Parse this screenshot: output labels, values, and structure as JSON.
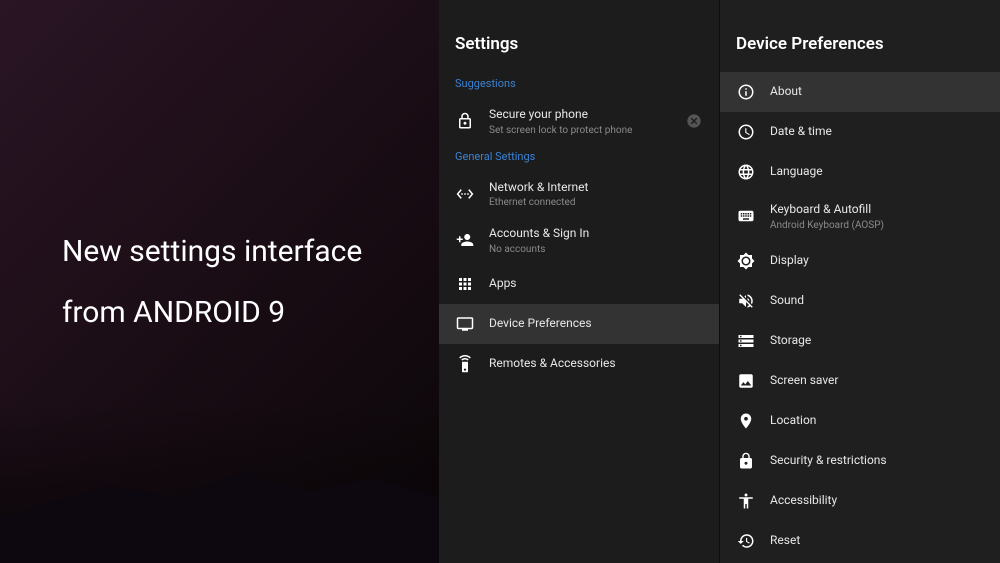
{
  "hero": {
    "line1": "New settings interface",
    "line2": "from ANDROID 9"
  },
  "settings": {
    "title": "Settings",
    "sections": {
      "suggestions_label": "Suggestions",
      "general_label": "General Settings"
    },
    "secure": {
      "label": "Secure your phone",
      "sub": "Set screen lock to protect phone"
    },
    "network": {
      "label": "Network & Internet",
      "sub": "Ethernet connected"
    },
    "accounts": {
      "label": "Accounts & Sign In",
      "sub": "No accounts"
    },
    "apps": {
      "label": "Apps"
    },
    "deviceprefs": {
      "label": "Device Preferences"
    },
    "remotes": {
      "label": "Remotes & Accessories"
    }
  },
  "deviceprefs": {
    "title": "Device Preferences",
    "about": {
      "label": "About"
    },
    "datetime": {
      "label": "Date & time"
    },
    "language": {
      "label": "Language"
    },
    "keyboard": {
      "label": "Keyboard & Autofill",
      "sub": "Android Keyboard (AOSP)"
    },
    "display": {
      "label": "Display"
    },
    "sound": {
      "label": "Sound"
    },
    "storage": {
      "label": "Storage"
    },
    "screensaver": {
      "label": "Screen saver"
    },
    "location": {
      "label": "Location"
    },
    "security": {
      "label": "Security & restrictions"
    },
    "accessibility": {
      "label": "Accessibility"
    },
    "reset": {
      "label": "Reset"
    }
  }
}
